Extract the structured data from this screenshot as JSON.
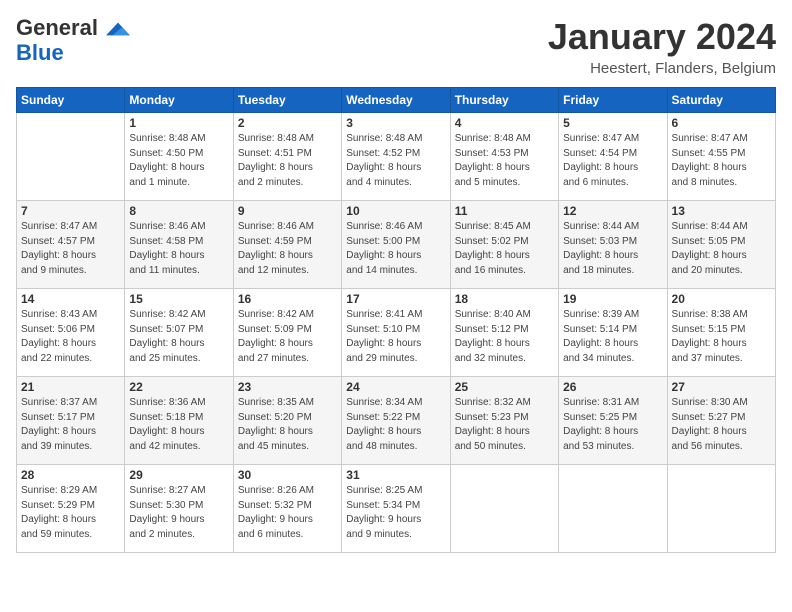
{
  "logo": {
    "general": "General",
    "blue": "Blue"
  },
  "header": {
    "month_title": "January 2024",
    "location": "Heestert, Flanders, Belgium"
  },
  "days_of_week": [
    "Sunday",
    "Monday",
    "Tuesday",
    "Wednesday",
    "Thursday",
    "Friday",
    "Saturday"
  ],
  "weeks": [
    [
      {
        "day": "",
        "info": ""
      },
      {
        "day": "1",
        "info": "Sunrise: 8:48 AM\nSunset: 4:50 PM\nDaylight: 8 hours\nand 1 minute."
      },
      {
        "day": "2",
        "info": "Sunrise: 8:48 AM\nSunset: 4:51 PM\nDaylight: 8 hours\nand 2 minutes."
      },
      {
        "day": "3",
        "info": "Sunrise: 8:48 AM\nSunset: 4:52 PM\nDaylight: 8 hours\nand 4 minutes."
      },
      {
        "day": "4",
        "info": "Sunrise: 8:48 AM\nSunset: 4:53 PM\nDaylight: 8 hours\nand 5 minutes."
      },
      {
        "day": "5",
        "info": "Sunrise: 8:47 AM\nSunset: 4:54 PM\nDaylight: 8 hours\nand 6 minutes."
      },
      {
        "day": "6",
        "info": "Sunrise: 8:47 AM\nSunset: 4:55 PM\nDaylight: 8 hours\nand 8 minutes."
      }
    ],
    [
      {
        "day": "7",
        "info": "Sunrise: 8:47 AM\nSunset: 4:57 PM\nDaylight: 8 hours\nand 9 minutes."
      },
      {
        "day": "8",
        "info": "Sunrise: 8:46 AM\nSunset: 4:58 PM\nDaylight: 8 hours\nand 11 minutes."
      },
      {
        "day": "9",
        "info": "Sunrise: 8:46 AM\nSunset: 4:59 PM\nDaylight: 8 hours\nand 12 minutes."
      },
      {
        "day": "10",
        "info": "Sunrise: 8:46 AM\nSunset: 5:00 PM\nDaylight: 8 hours\nand 14 minutes."
      },
      {
        "day": "11",
        "info": "Sunrise: 8:45 AM\nSunset: 5:02 PM\nDaylight: 8 hours\nand 16 minutes."
      },
      {
        "day": "12",
        "info": "Sunrise: 8:44 AM\nSunset: 5:03 PM\nDaylight: 8 hours\nand 18 minutes."
      },
      {
        "day": "13",
        "info": "Sunrise: 8:44 AM\nSunset: 5:05 PM\nDaylight: 8 hours\nand 20 minutes."
      }
    ],
    [
      {
        "day": "14",
        "info": "Sunrise: 8:43 AM\nSunset: 5:06 PM\nDaylight: 8 hours\nand 22 minutes."
      },
      {
        "day": "15",
        "info": "Sunrise: 8:42 AM\nSunset: 5:07 PM\nDaylight: 8 hours\nand 25 minutes."
      },
      {
        "day": "16",
        "info": "Sunrise: 8:42 AM\nSunset: 5:09 PM\nDaylight: 8 hours\nand 27 minutes."
      },
      {
        "day": "17",
        "info": "Sunrise: 8:41 AM\nSunset: 5:10 PM\nDaylight: 8 hours\nand 29 minutes."
      },
      {
        "day": "18",
        "info": "Sunrise: 8:40 AM\nSunset: 5:12 PM\nDaylight: 8 hours\nand 32 minutes."
      },
      {
        "day": "19",
        "info": "Sunrise: 8:39 AM\nSunset: 5:14 PM\nDaylight: 8 hours\nand 34 minutes."
      },
      {
        "day": "20",
        "info": "Sunrise: 8:38 AM\nSunset: 5:15 PM\nDaylight: 8 hours\nand 37 minutes."
      }
    ],
    [
      {
        "day": "21",
        "info": "Sunrise: 8:37 AM\nSunset: 5:17 PM\nDaylight: 8 hours\nand 39 minutes."
      },
      {
        "day": "22",
        "info": "Sunrise: 8:36 AM\nSunset: 5:18 PM\nDaylight: 8 hours\nand 42 minutes."
      },
      {
        "day": "23",
        "info": "Sunrise: 8:35 AM\nSunset: 5:20 PM\nDaylight: 8 hours\nand 45 minutes."
      },
      {
        "day": "24",
        "info": "Sunrise: 8:34 AM\nSunset: 5:22 PM\nDaylight: 8 hours\nand 48 minutes."
      },
      {
        "day": "25",
        "info": "Sunrise: 8:32 AM\nSunset: 5:23 PM\nDaylight: 8 hours\nand 50 minutes."
      },
      {
        "day": "26",
        "info": "Sunrise: 8:31 AM\nSunset: 5:25 PM\nDaylight: 8 hours\nand 53 minutes."
      },
      {
        "day": "27",
        "info": "Sunrise: 8:30 AM\nSunset: 5:27 PM\nDaylight: 8 hours\nand 56 minutes."
      }
    ],
    [
      {
        "day": "28",
        "info": "Sunrise: 8:29 AM\nSunset: 5:29 PM\nDaylight: 8 hours\nand 59 minutes."
      },
      {
        "day": "29",
        "info": "Sunrise: 8:27 AM\nSunset: 5:30 PM\nDaylight: 9 hours\nand 2 minutes."
      },
      {
        "day": "30",
        "info": "Sunrise: 8:26 AM\nSunset: 5:32 PM\nDaylight: 9 hours\nand 6 minutes."
      },
      {
        "day": "31",
        "info": "Sunrise: 8:25 AM\nSunset: 5:34 PM\nDaylight: 9 hours\nand 9 minutes."
      },
      {
        "day": "",
        "info": ""
      },
      {
        "day": "",
        "info": ""
      },
      {
        "day": "",
        "info": ""
      }
    ]
  ]
}
